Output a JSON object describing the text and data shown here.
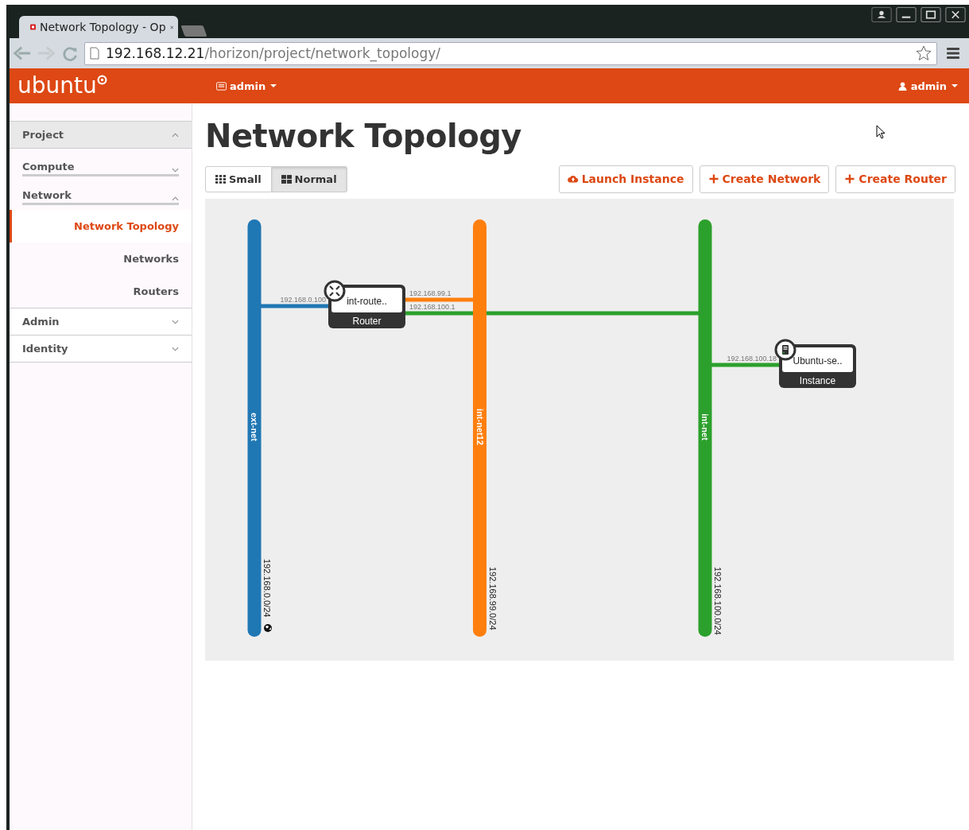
{
  "browser": {
    "tab_title": "Network Topology - Op",
    "url_host": "192.168.12.21",
    "url_path": "/horizon/project/network_topology/"
  },
  "header": {
    "brand": "ubuntu",
    "project_menu": "admin",
    "user_menu": "admin"
  },
  "sidebar": {
    "sections": [
      {
        "label": "Project",
        "expanded": true,
        "children": [
          {
            "label": "Compute",
            "expanded": false
          },
          {
            "label": "Network",
            "expanded": true,
            "children": [
              {
                "label": "Network Topology",
                "selected": true
              },
              {
                "label": "Networks",
                "selected": false
              },
              {
                "label": "Routers",
                "selected": false
              }
            ]
          }
        ]
      },
      {
        "label": "Admin",
        "expanded": false
      },
      {
        "label": "Identity",
        "expanded": false
      }
    ]
  },
  "page": {
    "title": "Network Topology",
    "view_toggle": [
      {
        "label": "Small",
        "kind": "small",
        "selected": false
      },
      {
        "label": "Normal",
        "kind": "normal",
        "selected": true
      }
    ],
    "actions": [
      {
        "label": "Launch Instance",
        "kind": "cloud"
      },
      {
        "label": "Create Network",
        "kind": "plus"
      },
      {
        "label": "Create Router",
        "kind": "plus"
      }
    ]
  },
  "topology": {
    "networks": [
      {
        "name": "ext-net",
        "cidr": "192.168.0.0/24",
        "color": "#1f77b4",
        "external": true
      },
      {
        "name": "int-net12",
        "cidr": "192.168.99.0/24",
        "color": "#ff7f0e",
        "external": false
      },
      {
        "name": "int-net",
        "cidr": "192.168.100.0/24",
        "color": "#2ca02c",
        "external": false
      }
    ],
    "devices": [
      {
        "kind": "router",
        "name": "int-route..",
        "type_label": "Router",
        "ports": [
          {
            "ip": "192.168.0.100"
          },
          {
            "ip": "192.168.99.1"
          },
          {
            "ip": "192.168.100.1"
          }
        ]
      },
      {
        "kind": "instance",
        "name": "Ubuntu-se..",
        "type_label": "Instance",
        "ports": [
          {
            "ip": "192.168.100.18"
          }
        ]
      }
    ]
  }
}
